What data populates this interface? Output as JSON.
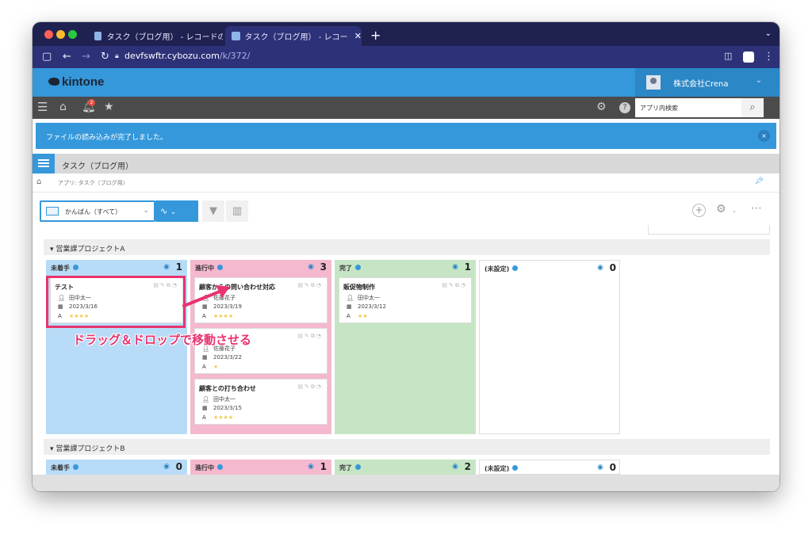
{
  "browser": {
    "tabs": [
      {
        "label": "タスク（ブログ用） - レコードの一覧",
        "active": false
      },
      {
        "label": "タスク（ブログ用） - レコードの···",
        "active": true
      }
    ],
    "new_tab": "+",
    "url_host": "devfswftr.cybozu.com",
    "url_path": "/k/372/"
  },
  "kintone": {
    "logo": "kintone",
    "user": "株式会社Crena",
    "notification_count": "2",
    "search_placeholder": "アプリ内検索",
    "notice": "ファイルの読み込みが完了しました。",
    "close": "×",
    "app_title": "タスク（ブログ用）",
    "breadcrumb": "アプリ: タスク（ブログ用）",
    "view_name": "かんばん（すべて）"
  },
  "groups": [
    {
      "name": "営業課プロジェクトA",
      "columns": [
        {
          "name": "未着手",
          "count": "1",
          "color": "#b8dcf7",
          "cards": [
            {
              "title": "テスト",
              "assignee": "田中太一",
              "date": "2023/3/16",
              "priority_label": "A",
              "stars": "★★★★"
            }
          ]
        },
        {
          "name": "進行中",
          "count": "3",
          "color": "#f4b8cf",
          "cards": [
            {
              "title": "顧客からの問い合わせ対応",
              "assignee": "佐藤花子",
              "date": "2023/3/19",
              "priority_label": "A",
              "stars": "★★★★"
            },
            {
              "title": "",
              "assignee": "佐藤花子",
              "date": "2023/3/22",
              "priority_label": "A",
              "stars": "★"
            },
            {
              "title": "顧客との打ち合わせ",
              "assignee": "田中太一",
              "date": "2023/3/15",
              "priority_label": "A",
              "stars": "★★★★"
            }
          ]
        },
        {
          "name": "完了",
          "count": "1",
          "color": "#c6e5c4",
          "cards": [
            {
              "title": "販促物制作",
              "assignee": "田中太一",
              "date": "2023/3/12",
              "priority_label": "A",
              "stars": "★★"
            }
          ]
        },
        {
          "name": "(未設定)",
          "count": "0",
          "color": "#ffffff",
          "cards": []
        }
      ]
    },
    {
      "name": "営業課プロジェクトB",
      "columns": [
        {
          "name": "未着手",
          "count": "0",
          "color": "#b8dcf7"
        },
        {
          "name": "進行中",
          "count": "1",
          "color": "#f4b8cf"
        },
        {
          "name": "完了",
          "count": "2",
          "color": "#c6e5c4"
        },
        {
          "name": "(未設定)",
          "count": "0",
          "color": "#ffffff"
        }
      ]
    }
  ],
  "annotation": "ドラッグ＆ドロップで移動させる",
  "accent_color": "#e8336e"
}
